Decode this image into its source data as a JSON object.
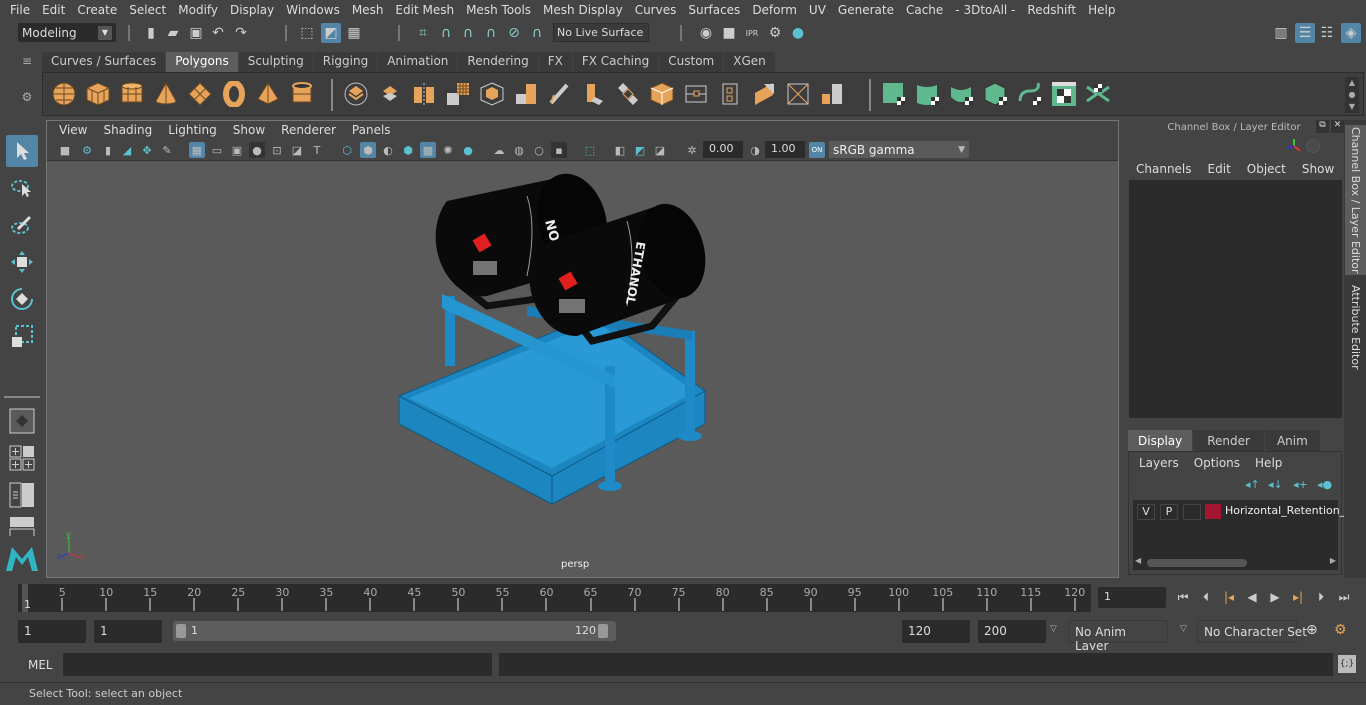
{
  "menubar": {
    "items": [
      "File",
      "Edit",
      "Create",
      "Select",
      "Modify",
      "Display",
      "Windows",
      "Mesh",
      "Edit Mesh",
      "Mesh Tools",
      "Mesh Display",
      "Curves",
      "Surfaces",
      "Deform",
      "UV",
      "Generate",
      "Cache",
      "- 3DtoAll -",
      "Redshift",
      "Help"
    ]
  },
  "statusline": {
    "mode": "Modeling",
    "live_surface": "No Live Surface"
  },
  "shelf": {
    "tabs": [
      "Curves / Surfaces",
      "Polygons",
      "Sculpting",
      "Rigging",
      "Animation",
      "Rendering",
      "FX",
      "FX Caching",
      "Custom",
      "XGen"
    ],
    "active_tab": "Polygons",
    "accent_orange": "#e8a35a",
    "accent_green": "#5fb88e"
  },
  "viewport": {
    "menu": [
      "View",
      "Shading",
      "Lighting",
      "Show",
      "Renderer",
      "Panels"
    ],
    "exposure": "0.00",
    "gamma_value": "1.00",
    "color_space": "sRGB gamma",
    "camera_label": "persp",
    "axis": {
      "x": "x",
      "y": "y",
      "z": "z"
    },
    "scene": {
      "barrel_label_1": "NOL",
      "barrel_label_2": "ETHANOL",
      "stand_color": "#1e8bc8",
      "barrel_color": "#0a0a0a"
    }
  },
  "channel_box": {
    "title": "Channel Box / Layer Editor",
    "menu": [
      "Channels",
      "Edit",
      "Object",
      "Show"
    ]
  },
  "layer_editor": {
    "tabs": [
      "Display",
      "Render",
      "Anim"
    ],
    "active_tab": "Display",
    "menu": [
      "Layers",
      "Options",
      "Help"
    ],
    "layers": [
      {
        "v": "V",
        "p": "P",
        "color": "#a31531",
        "name": "Horizontal_Retention_"
      }
    ]
  },
  "side_tabs": [
    "Channel Box / Layer Editor",
    "Attribute Editor"
  ],
  "timeline": {
    "ticks": [
      5,
      10,
      15,
      20,
      25,
      30,
      35,
      40,
      45,
      50,
      55,
      60,
      65,
      70,
      75,
      80,
      85,
      90,
      95,
      100,
      105,
      110,
      115,
      120
    ],
    "start_marker": "1",
    "current_frame": "1"
  },
  "range": {
    "start": "1",
    "playback_start": "1",
    "slider_min": "1",
    "slider_max": "120",
    "playback_end": "120",
    "end": "200",
    "anim_layer": "No Anim Layer",
    "character_set": "No Character Set"
  },
  "command": {
    "lang": "MEL",
    "value": ""
  },
  "help_line": "Select Tool: select an object"
}
